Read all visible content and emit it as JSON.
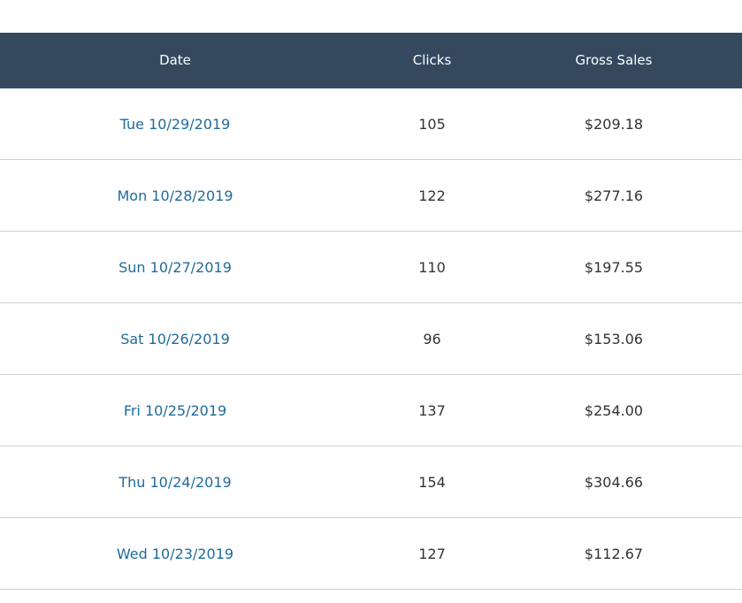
{
  "table": {
    "columns": [
      "Date",
      "Clicks",
      "Gross Sales"
    ],
    "rows": [
      {
        "date": "Tue 10/29/2019",
        "clicks": "105",
        "gross_sales": "$209.18"
      },
      {
        "date": "Mon 10/28/2019",
        "clicks": "122",
        "gross_sales": "$277.16"
      },
      {
        "date": "Sun 10/27/2019",
        "clicks": "110",
        "gross_sales": "$197.55"
      },
      {
        "date": "Sat 10/26/2019",
        "clicks": "96",
        "gross_sales": "$153.06"
      },
      {
        "date": "Fri 10/25/2019",
        "clicks": "137",
        "gross_sales": "$254.00"
      },
      {
        "date": "Thu 10/24/2019",
        "clicks": "154",
        "gross_sales": "$304.66"
      },
      {
        "date": "Wed 10/23/2019",
        "clicks": "127",
        "gross_sales": "$112.67"
      }
    ]
  },
  "colors": {
    "header_bg": "#34495e",
    "header_text": "#ffffff",
    "link": "#1f6b9c",
    "body_text": "#333333",
    "divider": "#cfcfcf"
  }
}
